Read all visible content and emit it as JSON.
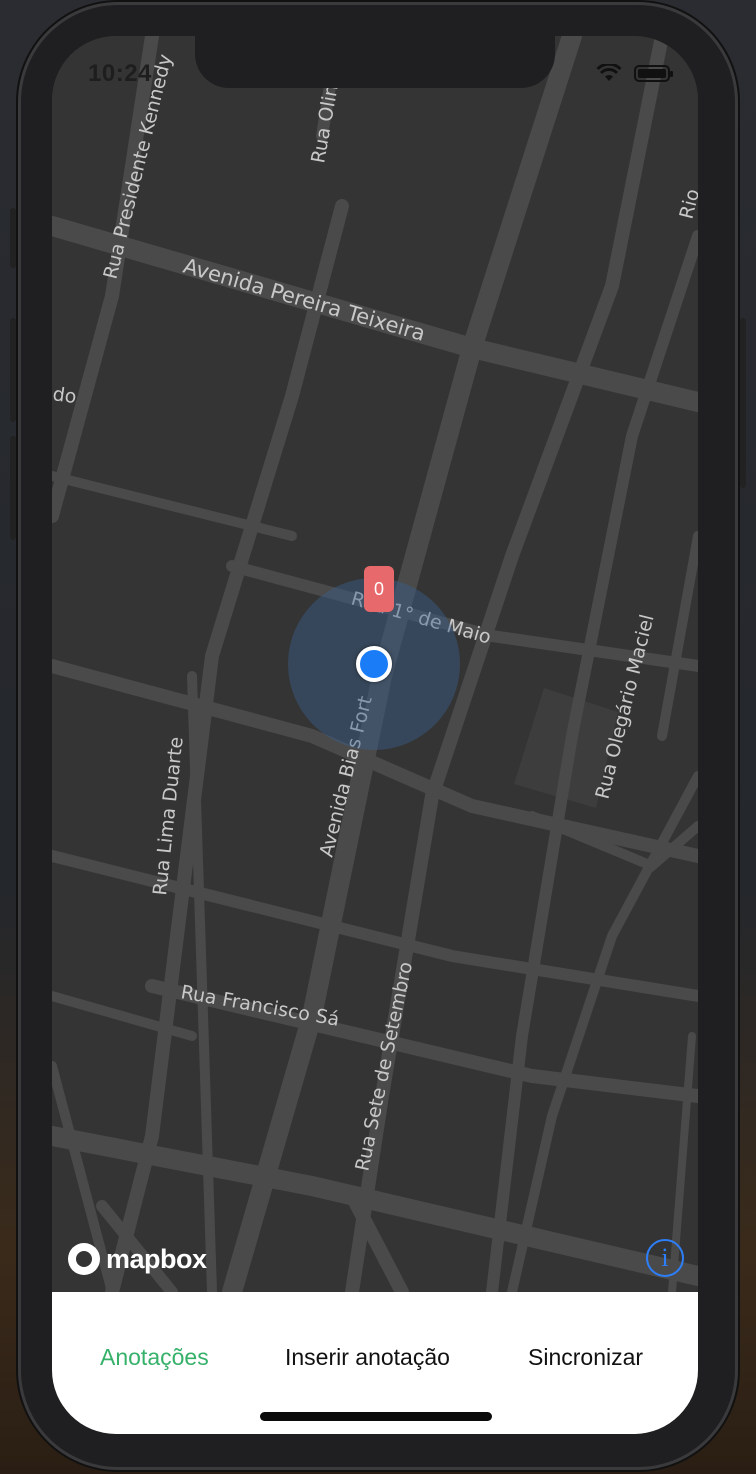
{
  "status_bar": {
    "time": "10:24"
  },
  "map": {
    "streets": {
      "presidente_kennedy": "Rua Presidente Kennedy",
      "olinda": "Rua Olin",
      "pereira_teixeira": "Avenida Pereira Teixeira",
      "rio_partial": "Rio",
      "do_partial": "do",
      "primeiro_de_maio": "Rua 1° de Maio",
      "bias_fortes": "Avenida Bias Fort",
      "lima_duarte": "Rua Lima Duarte",
      "olegario_maciel": "Rua Olegário Maciel",
      "francisco_sa": "Rua Francisco Sá",
      "sete_de_setembro": "Rua Sete de Setembro"
    },
    "pin_label": "0",
    "attribution": "mapbox",
    "info_glyph": "i"
  },
  "tabs": [
    {
      "label": "Anotações",
      "active": true
    },
    {
      "label": "Inserir anotação",
      "active": false
    },
    {
      "label": "Sincronizar",
      "active": false
    }
  ],
  "colors": {
    "accent": "#36b16a",
    "user_location": "#1a7cf7",
    "pin": "#e8696b",
    "info": "#2d7ff9"
  }
}
